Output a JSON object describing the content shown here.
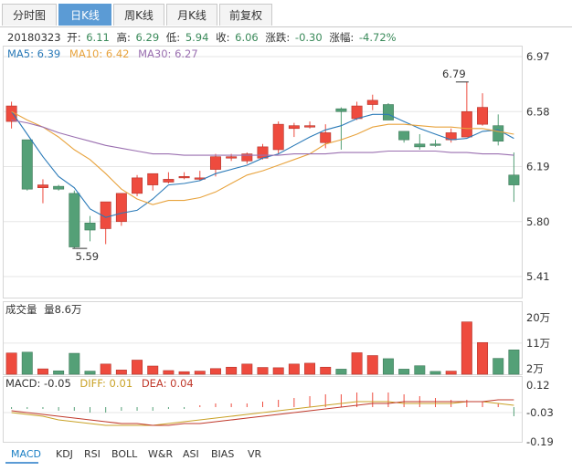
{
  "tabs": [
    {
      "label": "分时图",
      "active": false
    },
    {
      "label": "日K线",
      "active": true
    },
    {
      "label": "周K线",
      "active": false
    },
    {
      "label": "月K线",
      "active": false
    },
    {
      "label": "前复权",
      "active": false
    }
  ],
  "header": {
    "date": "20180323",
    "open_label": "开:",
    "open": "6.11",
    "high_label": "高:",
    "high": "6.29",
    "low_label": "低:",
    "low": "5.94",
    "close_label": "收:",
    "close": "6.06",
    "change_label": "涨跌:",
    "change": "-0.30",
    "pct_label": "涨幅:",
    "pct": "-4.72%"
  },
  "ma_legend": [
    {
      "label": "MA5: 6.39",
      "color": "#2a7ab8"
    },
    {
      "label": "MA10: 6.42",
      "color": "#e8a33d"
    },
    {
      "label": "MA30: 6.27",
      "color": "#9a6fb0"
    }
  ],
  "volume_header": {
    "label": "成交量",
    "value": "量8.6万"
  },
  "macd_header": {
    "macd": "MACD: -0.05",
    "diff": "DIFF: 0.01",
    "dea": "DEA: 0.04"
  },
  "indicator_tabs": [
    "MACD",
    "KDJ",
    "RSI",
    "BOLL",
    "W&R",
    "ASI",
    "BIAS",
    "VR"
  ],
  "colors": {
    "up": "#ee4b3e",
    "down": "#54a077",
    "ma5": "#2a7ab8",
    "ma10": "#e8a33d",
    "ma30": "#9a6fb0"
  },
  "chart_data": {
    "type": "candlestick",
    "price_axis": {
      "ticks": [
        "6.97",
        "6.58",
        "6.19",
        "5.80",
        "5.41"
      ],
      "range": [
        5.41,
        6.97
      ]
    },
    "volume_axis": {
      "ticks": [
        "20万",
        "11万",
        "2万"
      ],
      "range": [
        0,
        20
      ]
    },
    "macd_axis": {
      "ticks": [
        "0.12",
        "-0.03",
        "-0.19"
      ],
      "range": [
        -0.19,
        0.12
      ]
    },
    "annotations": {
      "high": "6.79",
      "low": "5.59"
    },
    "candles": [
      [
        6.51,
        6.46,
        6.62,
        6.65
      ],
      [
        6.38,
        6.37,
        6.03,
        6.02
      ],
      [
        6.04,
        6.1,
        6.06,
        5.93
      ],
      [
        6.05,
        6.06,
        6.03,
        6.02
      ],
      [
        6.0,
        6.02,
        5.62,
        5.61
      ],
      [
        5.79,
        5.84,
        5.74,
        5.66
      ],
      [
        5.75,
        5.93,
        5.94,
        5.64
      ],
      [
        5.8,
        5.98,
        6.0,
        5.77
      ],
      [
        6.0,
        6.13,
        6.11,
        5.98
      ],
      [
        6.06,
        6.13,
        6.14,
        6.02
      ],
      [
        6.08,
        6.15,
        6.1,
        6.07
      ],
      [
        6.11,
        6.15,
        6.12,
        6.1
      ],
      [
        6.1,
        6.16,
        6.11,
        6.09
      ],
      [
        6.17,
        6.28,
        6.26,
        6.12
      ],
      [
        6.25,
        6.28,
        6.26,
        6.23
      ],
      [
        6.23,
        6.29,
        6.28,
        6.21
      ],
      [
        6.25,
        6.35,
        6.33,
        6.24
      ],
      [
        6.31,
        6.51,
        6.49,
        6.28
      ],
      [
        6.46,
        6.5,
        6.48,
        6.4
      ],
      [
        6.47,
        6.51,
        6.48,
        6.46
      ],
      [
        6.36,
        6.49,
        6.43,
        6.32
      ],
      [
        6.6,
        6.61,
        6.58,
        6.31
      ],
      [
        6.53,
        6.65,
        6.62,
        6.52
      ],
      [
        6.63,
        6.7,
        6.66,
        6.59
      ],
      [
        6.63,
        6.64,
        6.52,
        6.52
      ],
      [
        6.44,
        6.44,
        6.38,
        6.36
      ],
      [
        6.35,
        6.42,
        6.33,
        6.31
      ],
      [
        6.35,
        6.38,
        6.34,
        6.33
      ],
      [
        6.38,
        6.46,
        6.43,
        6.36
      ],
      [
        6.4,
        6.79,
        6.58,
        6.4
      ],
      [
        6.49,
        6.71,
        6.61,
        6.48
      ],
      [
        6.48,
        6.56,
        6.37,
        6.34
      ],
      [
        6.13,
        6.29,
        6.06,
        5.94
      ]
    ],
    "volume": [
      7.5,
      7.8,
      1.9,
      1.2,
      7.4,
      1.1,
      3.6,
      1.5,
      5.0,
      2.9,
      1.3,
      0.9,
      1.1,
      2.0,
      2.5,
      3.6,
      2.4,
      2.3,
      3.6,
      3.9,
      2.5,
      1.8,
      7.6,
      6.6,
      5.5,
      1.8,
      3.0,
      1.0,
      1.1,
      18.5,
      11.2,
      5.6,
      8.6
    ],
    "ma5": [
      6.58,
      6.42,
      6.26,
      6.12,
      6.04,
      5.89,
      5.83,
      5.86,
      5.88,
      5.96,
      6.06,
      6.07,
      6.09,
      6.14,
      6.17,
      6.2,
      6.25,
      6.28,
      6.34,
      6.4,
      6.45,
      6.48,
      6.53,
      6.56,
      6.56,
      6.51,
      6.46,
      6.42,
      6.38,
      6.39,
      6.44,
      6.45,
      6.39
    ],
    "ma10": [
      6.58,
      6.52,
      6.47,
      6.4,
      6.31,
      6.24,
      6.14,
      6.03,
      5.96,
      5.92,
      5.95,
      5.95,
      5.97,
      6.01,
      6.07,
      6.13,
      6.16,
      6.2,
      6.24,
      6.28,
      6.35,
      6.38,
      6.42,
      6.47,
      6.49,
      6.49,
      6.48,
      6.47,
      6.47,
      6.46,
      6.46,
      6.44,
      6.42
    ],
    "ma30": [
      6.52,
      6.5,
      6.47,
      6.43,
      6.4,
      6.37,
      6.34,
      6.32,
      6.3,
      6.28,
      6.28,
      6.27,
      6.27,
      6.27,
      6.27,
      6.27,
      6.27,
      6.27,
      6.28,
      6.28,
      6.28,
      6.29,
      6.29,
      6.29,
      6.3,
      6.3,
      6.3,
      6.3,
      6.29,
      6.29,
      6.28,
      6.28,
      6.27
    ],
    "macd_bars": [
      -0.01,
      -0.01,
      -0.01,
      -0.02,
      -0.02,
      -0.03,
      -0.03,
      -0.02,
      -0.02,
      -0.02,
      -0.01,
      -0.01,
      0.01,
      0.02,
      0.02,
      0.02,
      0.03,
      0.04,
      0.05,
      0.06,
      0.07,
      0.07,
      0.08,
      0.08,
      0.08,
      0.07,
      0.06,
      0.05,
      0.04,
      0.04,
      0.03,
      0.02,
      -0.05
    ],
    "diff": [
      -0.03,
      -0.04,
      -0.05,
      -0.07,
      -0.08,
      -0.09,
      -0.1,
      -0.1,
      -0.1,
      -0.1,
      -0.09,
      -0.08,
      -0.07,
      -0.06,
      -0.05,
      -0.04,
      -0.03,
      -0.02,
      -0.01,
      0.0,
      0.01,
      0.02,
      0.03,
      0.03,
      0.03,
      0.02,
      0.02,
      0.02,
      0.02,
      0.03,
      0.03,
      0.02,
      0.01
    ],
    "dea": [
      -0.02,
      -0.03,
      -0.04,
      -0.05,
      -0.06,
      -0.07,
      -0.08,
      -0.09,
      -0.09,
      -0.1,
      -0.1,
      -0.09,
      -0.09,
      -0.08,
      -0.07,
      -0.06,
      -0.05,
      -0.04,
      -0.03,
      -0.02,
      -0.01,
      0.0,
      0.01,
      0.02,
      0.02,
      0.03,
      0.03,
      0.03,
      0.03,
      0.03,
      0.03,
      0.04,
      0.04
    ]
  }
}
